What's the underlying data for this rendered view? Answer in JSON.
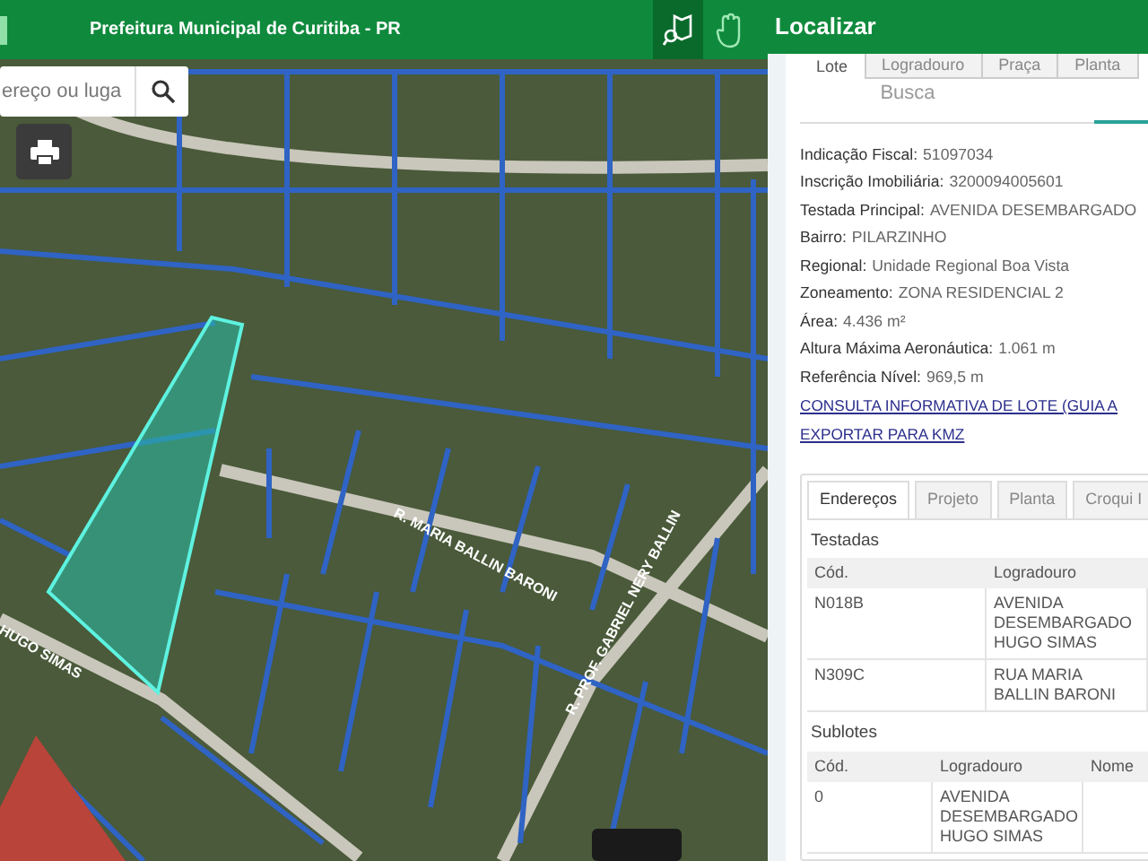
{
  "header": {
    "title": "Prefeitura Municipal de Curitiba - PR"
  },
  "search": {
    "placeholder": "ereço ou luga"
  },
  "map": {
    "road_labels": [
      {
        "text": "R. MARIA BALLIN BARONI",
        "kind": "maria"
      },
      {
        "text": "R. PROF. GABRIEL NERY BALLIN",
        "kind": "gabriel"
      },
      {
        "text": "HUGO SIMAS",
        "kind": "hugo"
      }
    ]
  },
  "panel": {
    "title": "Localizar",
    "tabs": [
      {
        "label": "Lote",
        "selected": true
      },
      {
        "label": "Logradouro",
        "selected": false
      },
      {
        "label": "Praça",
        "selected": false
      },
      {
        "label": "Planta",
        "selected": false
      }
    ],
    "subtab": "Busca",
    "fields": [
      {
        "label": "Indicação Fiscal:",
        "value": "51097034"
      },
      {
        "label": "Inscrição Imobiliária:",
        "value": "3200094005601"
      },
      {
        "label": "Testada Principal:",
        "value": "AVENIDA DESEMBARGADO"
      },
      {
        "label": "Bairro:",
        "value": "PILARZINHO"
      },
      {
        "label": "Regional:",
        "value": "Unidade Regional Boa Vista"
      },
      {
        "label": "Zoneamento:",
        "value": "ZONA RESIDENCIAL 2"
      },
      {
        "label": "Área:",
        "value": "4.436 m²"
      },
      {
        "label": "Altura Máxima Aeronáutica:",
        "value": "1.061 m"
      },
      {
        "label": "Referência Nível:",
        "value": "969,5 m"
      }
    ],
    "links": [
      "CONSULTA INFORMATIVA DE LOTE (GUIA A",
      "EXPORTAR PARA KMZ"
    ],
    "detail_tabs": [
      {
        "label": "Endereços",
        "selected": true
      },
      {
        "label": "Projeto",
        "selected": false
      },
      {
        "label": "Planta",
        "selected": false
      },
      {
        "label": "Croqui I",
        "selected": false
      }
    ],
    "testadas": {
      "title": "Testadas",
      "columns": [
        "Cód.",
        "Logradouro"
      ],
      "rows": [
        [
          "N018B",
          "AVENIDA DESEMBARGADO HUGO SIMAS"
        ],
        [
          "N309C",
          "RUA MARIA BALLIN BARONI"
        ]
      ]
    },
    "sublotes": {
      "title": "Sublotes",
      "columns": [
        "Cód.",
        "Logradouro",
        "Nome"
      ],
      "rows": [
        [
          "0",
          "AVENIDA DESEMBARGADO HUGO SIMAS"
        ]
      ]
    }
  }
}
